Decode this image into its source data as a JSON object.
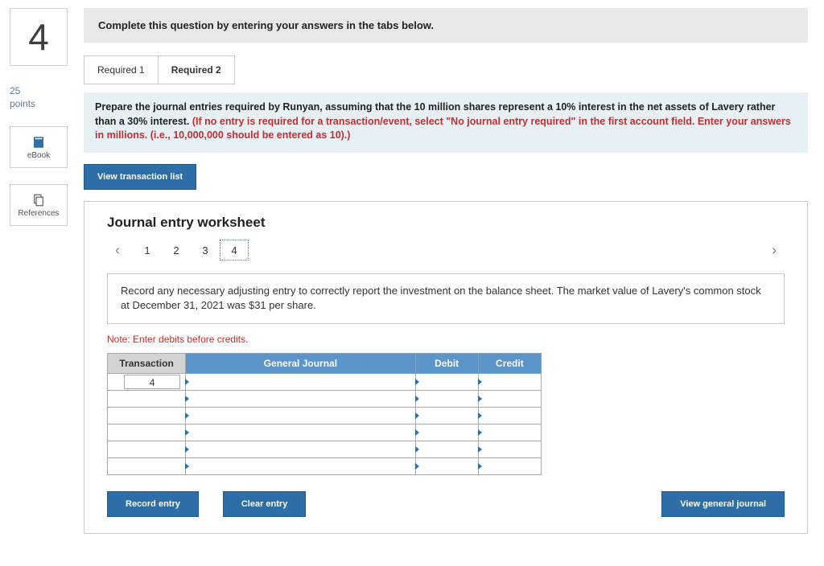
{
  "question_number": "4",
  "points": {
    "value": "25",
    "label": "points"
  },
  "side_buttons": {
    "ebook": "eBook",
    "references": "References"
  },
  "header": "Complete this question by entering your answers in the tabs below.",
  "tabs": [
    "Required 1",
    "Required 2"
  ],
  "active_tab_index": 1,
  "instruction": {
    "black": "Prepare the journal entries required by Runyan, assuming that the 10 million shares represent a 10% interest in the net assets of Lavery rather than a 30% interest. ",
    "red": "(If no entry is required for a transaction/event, select \"No journal entry required\" in the first account field. Enter your answers in millions. (i.e., 10,000,000 should be entered as 10).)"
  },
  "view_transaction_list": "View transaction list",
  "worksheet": {
    "title": "Journal entry worksheet",
    "steps": [
      "1",
      "2",
      "3",
      "4"
    ],
    "selected_step_index": 3,
    "prompt": "Record any necessary adjusting entry to correctly report the investment on the balance sheet. The market value of Lavery's common stock at December 31, 2021 was $31 per share.",
    "note": "Note: Enter debits before credits.",
    "columns": {
      "transaction": "Transaction",
      "general_journal": "General Journal",
      "debit": "Debit",
      "credit": "Credit"
    },
    "transaction_value": "4",
    "buttons": {
      "record": "Record entry",
      "clear": "Clear entry",
      "view_journal": "View general journal"
    }
  }
}
